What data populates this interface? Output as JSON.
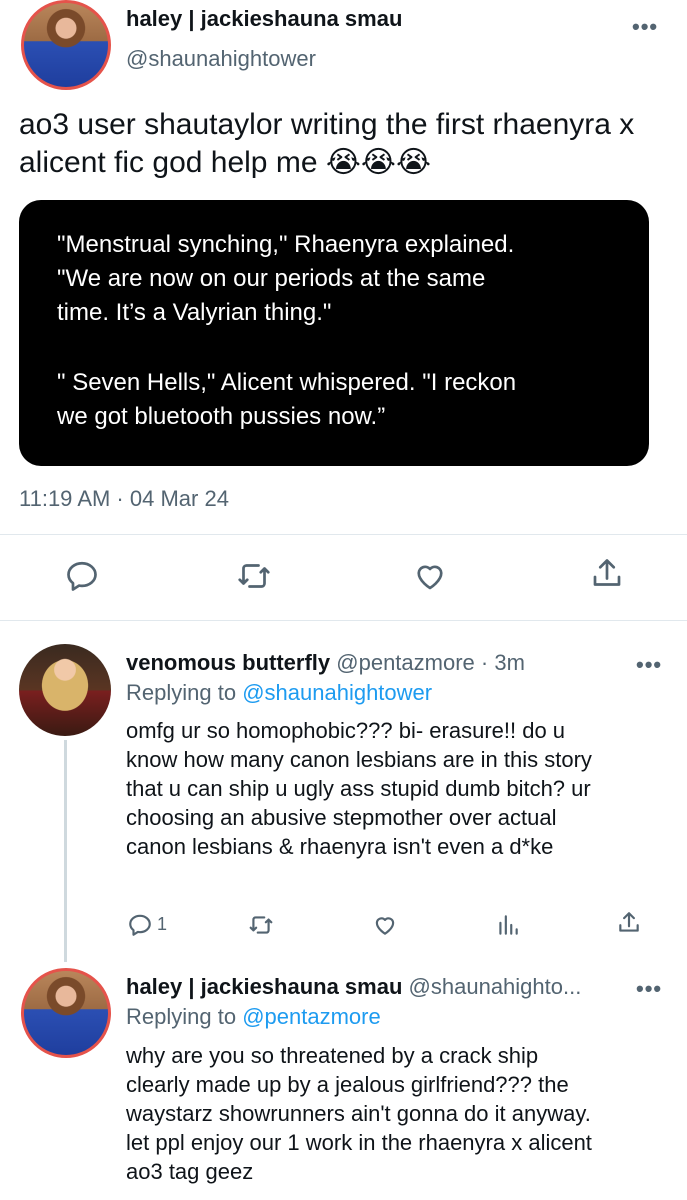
{
  "tweet": {
    "author_name": "haley | jackieshauna smau",
    "author_handle": "@shaunahightower",
    "more_label": "•••",
    "text": "ao3 user shautaylor writing the first rhaenyra x alicent fic god help me 😭😭😭",
    "quote_lines": [
      "\"Menstrual synching,\" Rhaenyra explained.",
      "\"We are now on our periods at the same",
      "time. It’s a Valyrian thing.\"",
      "\" Seven Hells,\" Alicent whispered. \"I reckon",
      "we got bluetooth pussies now.”"
    ],
    "timestamp": "11:19 AM · 04 Mar 24",
    "actions": [
      "reply-icon",
      "retweet-icon",
      "like-icon",
      "share-icon"
    ]
  },
  "reply1": {
    "author_name": "venomous butterfly",
    "author_handle": "@pentazmore",
    "time": "· 3m",
    "replying_prefix": "Replying to",
    "replying_to": "@shaunahightower",
    "body_lines": [
      "omfg ur so homophobic??? bi- erasure!! do u",
      "know how many canon lesbians are in this story",
      "that u can ship u ugly ass stupid dumb bitch? ur",
      "choosing an abusive stepmother over actual",
      "canon lesbians & rhaenyra isn't even a d*ke"
    ],
    "reply_count": "1",
    "more_label": "•••",
    "actions": [
      "reply-icon",
      "retweet-icon",
      "like-icon",
      "analytics-icon",
      "share-icon"
    ]
  },
  "reply2": {
    "author_name": "haley | jackieshauna smau",
    "author_handle": "@shaunahighto...",
    "replying_prefix": "Replying to",
    "replying_to": "@pentazmore",
    "more_label": "•••",
    "body_lines": [
      "why are you so threatened by a crack ship",
      "clearly made up by a jealous girlfriend??? the",
      "waystarz showrunners ain't gonna do it anyway.",
      "let ppl enjoy our 1 work in the rhaenyra x alicent",
      "ao3 tag geez"
    ]
  },
  "colors": {
    "link": "#1d9bf0",
    "secondary_text": "#536471",
    "quote_bg": "#000000"
  }
}
